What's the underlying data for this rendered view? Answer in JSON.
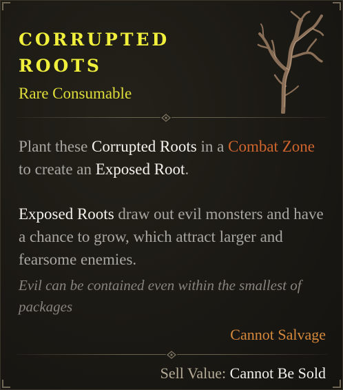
{
  "item": {
    "name_line1": "Corrupted",
    "name_line2": "Roots",
    "type": "Rare Consumable",
    "icon": "corrupted-roots-icon"
  },
  "description": {
    "p1": [
      {
        "text": "Plant these ",
        "style": "normal"
      },
      {
        "text": "Corrupted Roots",
        "style": "white"
      },
      {
        "text": " in a ",
        "style": "normal"
      },
      {
        "text": "Combat Zone",
        "style": "orange"
      },
      {
        "text": " to create an ",
        "style": "normal"
      },
      {
        "text": "Exposed Root",
        "style": "white"
      },
      {
        "text": ".",
        "style": "normal"
      }
    ],
    "p2": [
      {
        "text": "Exposed Roots",
        "style": "white"
      },
      {
        "text": " draw out evil monsters and have a chance to grow, which attract larger and fearsome enemies.",
        "style": "normal"
      }
    ]
  },
  "flavor_text": "Evil can be contained even within the smallest of packages",
  "salvage_text": "Cannot Salvage",
  "sell": {
    "label": "Sell Value:",
    "value": "Cannot Be Sold"
  },
  "colors": {
    "title": "#f0ef3c",
    "rarity": "#e0de3a",
    "highlight": "#f3f2ee",
    "keyword": "#d0652e",
    "body": "#a9a7a3",
    "flavor": "#87847e",
    "salvage": "#d6893c"
  }
}
